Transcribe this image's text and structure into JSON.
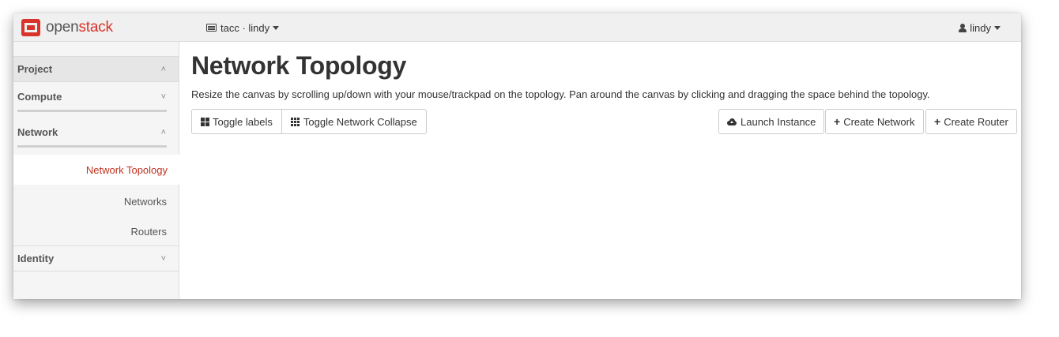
{
  "topnav": {
    "brand_open": "open",
    "brand_stack": "stack",
    "project_label": "tacc · lindy",
    "user_label": "lindy"
  },
  "sidebar": {
    "project": {
      "label": "Project",
      "chevron": "^"
    },
    "compute": {
      "label": "Compute",
      "chevron": "v"
    },
    "network": {
      "label": "Network",
      "chevron": "^"
    },
    "items": [
      {
        "label": "Network Topology",
        "active": true
      },
      {
        "label": "Networks",
        "active": false
      },
      {
        "label": "Routers",
        "active": false
      }
    ],
    "identity": {
      "label": "Identity",
      "chevron": "v"
    }
  },
  "main": {
    "title": "Network Topology",
    "help": "Resize the canvas by scrolling up/down with your mouse/trackpad on the topology. Pan around the canvas by clicking and dragging the space behind the topology.",
    "toggle_labels": "Toggle labels",
    "toggle_collapse": "Toggle Network Collapse",
    "launch_instance": "Launch Instance",
    "create_network": "Create Network",
    "create_router": "Create Router"
  },
  "colors": {
    "brand_red": "#d9342b",
    "active_link": "#c1311f"
  },
  "icons": {
    "logo": "openstack-logo-icon",
    "project": "server-icon",
    "user": "user-icon",
    "labels": "th-large-icon",
    "collapse": "th-icon",
    "launch": "cloud-upload-icon",
    "plus": "plus-icon"
  }
}
